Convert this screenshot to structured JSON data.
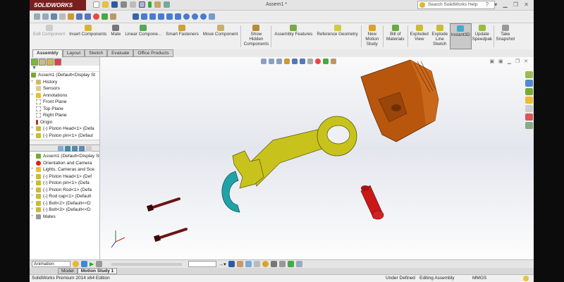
{
  "app": {
    "logo": "SOLIDWORKS",
    "document_title": "Assem1 *",
    "search_placeholder": "Search SolidWorks Help"
  },
  "command_manager": [
    {
      "label": "Edit Component",
      "disabled": true
    },
    {
      "label": "Insert Components"
    },
    {
      "label": "Mate"
    },
    {
      "label": "Linear Compone..."
    },
    {
      "label": "Smart Fasteners"
    },
    {
      "label": "Move Component"
    },
    {
      "label": "Show Hidden Components"
    },
    {
      "label": "Assembly Features"
    },
    {
      "label": "Reference Geometry"
    },
    {
      "label": "New Motion Study"
    },
    {
      "label": "Bill of Materials"
    },
    {
      "label": "Exploded View"
    },
    {
      "label": "Explode Line Sketch"
    },
    {
      "label": "Instant3D",
      "active": true
    },
    {
      "label": "Update Speedpak"
    },
    {
      "label": "Take Snapshot"
    }
  ],
  "tabs": [
    "Assembly",
    "Layout",
    "Sketch",
    "Evaluate",
    "Office Products"
  ],
  "feature_tree": [
    "Assem1  (Default<Display St",
    "History",
    "Sensors",
    "Annotations",
    "Front Plane",
    "Top Plane",
    "Right Plane",
    "Origin",
    "(-) Piston Head<1> (Defa",
    "(-) Piston pin<1> (Defaul"
  ],
  "motion_tree": [
    "Assem1  (Default<Display St",
    "Orientation and Camera",
    "Lights, Cameras and Sce",
    "(-) Piston Head<1> (Def",
    "(-) Piston pin<1> (Defa",
    "(-) Piston Rod<1> (Defa",
    "(-) Rod cap<1> (Default",
    "(-) Bolt<2> (Default<<D",
    "(-) Bolt<3> (Default<<D",
    "Mates"
  ],
  "animation": {
    "type": "Animation"
  },
  "bottom_tabs": [
    "Model",
    "Motion Study 1"
  ],
  "status": {
    "edition": "SolidWorks Premium 2014 x64 Edition",
    "state": "Under Defined",
    "mode": "Editing Assembly",
    "units": "MMGS"
  },
  "colors": {
    "piston": "#b8560e",
    "rod": "#c8c21c",
    "cap": "#1fa3a8",
    "pin": "#c81818",
    "bolt": "#6b1414"
  }
}
